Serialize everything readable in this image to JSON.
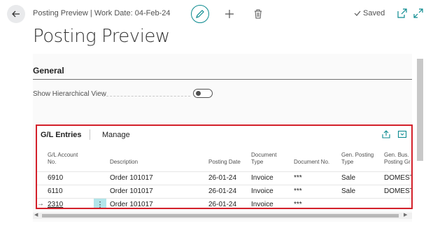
{
  "header": {
    "title": "Posting Preview | Work Date: 04-Feb-24",
    "saved_label": "Saved"
  },
  "page": {
    "title": "Posting Preview"
  },
  "general": {
    "title": "General",
    "show_hierarchical_label": "Show Hierarchical View",
    "show_hierarchical_on": false
  },
  "gl_entries": {
    "title": "G/L Entries",
    "manage_label": "Manage",
    "columns": [
      {
        "line1": "G/L Account",
        "line2": "No."
      },
      {
        "line1": "Description",
        "line2": ""
      },
      {
        "line1": "Posting Date",
        "line2": ""
      },
      {
        "line1": "Document",
        "line2": "Type"
      },
      {
        "line1": "Document No.",
        "line2": ""
      },
      {
        "line1": "Gen. Posting",
        "line2": "Type"
      },
      {
        "line1": "Gen. Bus.",
        "line2": "Posting Gr"
      }
    ],
    "rows": [
      {
        "account": "6910",
        "description": "Order 101017",
        "posting_date": "26-01-24",
        "doc_type": "Invoice",
        "doc_no": "***",
        "gen_posting_type": "Sale",
        "gen_bus_group": "DOMEST"
      },
      {
        "account": "6110",
        "description": "Order 101017",
        "posting_date": "26-01-24",
        "doc_type": "Invoice",
        "doc_no": "***",
        "gen_posting_type": "Sale",
        "gen_bus_group": "DOMEST"
      },
      {
        "account": "2310",
        "description": "Order 101017",
        "posting_date": "26-01-24",
        "doc_type": "Invoice",
        "doc_no": "***",
        "gen_posting_type": "",
        "gen_bus_group": ""
      }
    ],
    "current_row_marker": "→",
    "row_menu_glyph": "⋮"
  },
  "icons": {
    "back": "back-arrow-icon",
    "edit": "pencil-icon",
    "new": "plus-icon",
    "delete": "trash-icon",
    "saved": "checkmark-icon",
    "open_new_window": "open-in-new-icon",
    "expand": "expand-icon",
    "share": "share-icon",
    "factbox": "pane-toggle-icon"
  },
  "colors": {
    "accent": "#0b8a8f",
    "highlight_border": "#d3202a",
    "row_menu_bg": "#b3e5ea"
  }
}
